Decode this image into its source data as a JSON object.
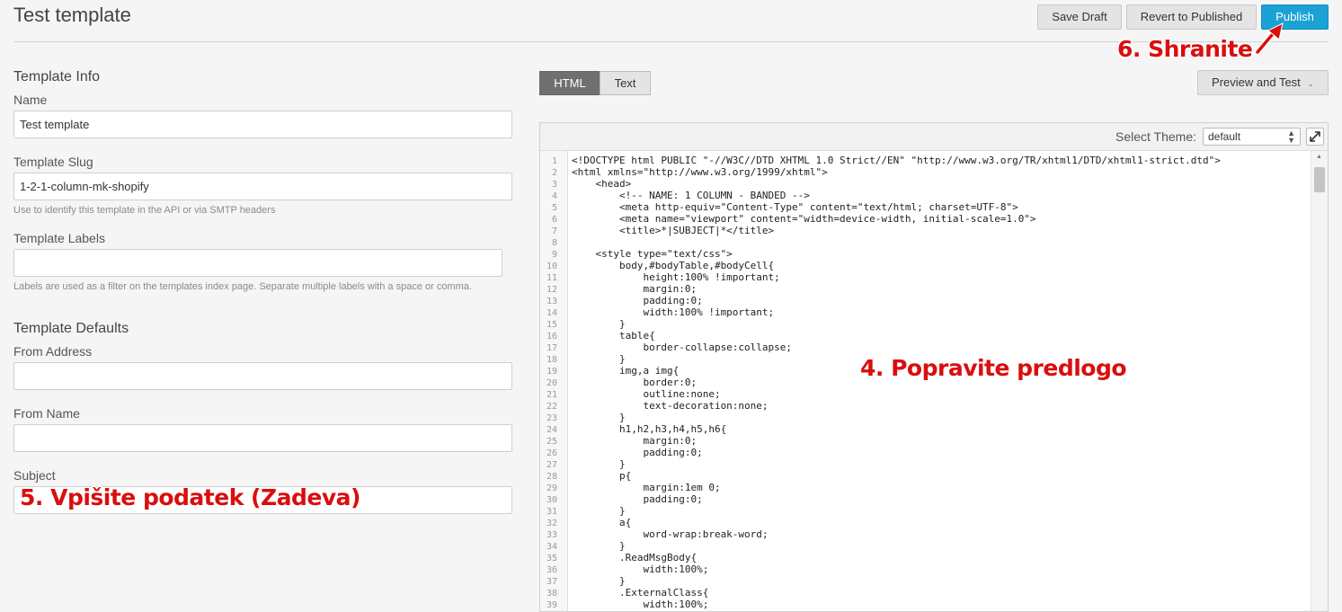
{
  "header": {
    "title": "Test template",
    "save_draft": "Save Draft",
    "revert": "Revert to Published",
    "publish": "Publish"
  },
  "template_info": {
    "section_title": "Template Info",
    "name_label": "Name",
    "name_value": "Test template",
    "slug_label": "Template Slug",
    "slug_value": "1-2-1-column-mk-shopify",
    "slug_help": "Use to identify this template in the API or via SMTP headers",
    "labels_label": "Template Labels",
    "labels_value": "",
    "labels_help": "Labels are used as a filter on the templates index page. Separate multiple labels with a space or comma."
  },
  "template_defaults": {
    "section_title": "Template Defaults",
    "from_address_label": "From Address",
    "from_address_value": "",
    "from_name_label": "From Name",
    "from_name_value": "",
    "subject_label": "Subject",
    "subject_value": ""
  },
  "editor": {
    "tabs": [
      {
        "label": "HTML",
        "active": true
      },
      {
        "label": "Text",
        "active": false
      }
    ],
    "preview_button": "Preview and Test",
    "theme_label": "Select Theme:",
    "theme_value": "default",
    "code": [
      "<!DOCTYPE html PUBLIC \"-//W3C//DTD XHTML 1.0 Strict//EN\" \"http://www.w3.org/TR/xhtml1/DTD/xhtml1-strict.dtd\">",
      "<html xmlns=\"http://www.w3.org/1999/xhtml\">",
      "    <head>",
      "        <!-- NAME: 1 COLUMN - BANDED -->",
      "        <meta http-equiv=\"Content-Type\" content=\"text/html; charset=UTF-8\">",
      "        <meta name=\"viewport\" content=\"width=device-width, initial-scale=1.0\">",
      "        <title>*|SUBJECT|*</title>",
      "",
      "    <style type=\"text/css\">",
      "        body,#bodyTable,#bodyCell{",
      "            height:100% !important;",
      "            margin:0;",
      "            padding:0;",
      "            width:100% !important;",
      "        }",
      "        table{",
      "            border-collapse:collapse;",
      "        }",
      "        img,a img{",
      "            border:0;",
      "            outline:none;",
      "            text-decoration:none;",
      "        }",
      "        h1,h2,h3,h4,h5,h6{",
      "            margin:0;",
      "            padding:0;",
      "        }",
      "        p{",
      "            margin:1em 0;",
      "            padding:0;",
      "        }",
      "        a{",
      "            word-wrap:break-word;",
      "        }",
      "        .ReadMsgBody{",
      "            width:100%;",
      "        }",
      "        .ExternalClass{",
      "            width:100%;"
    ]
  },
  "annotations": {
    "save": "6. Shranite",
    "edit": "4. Popravite predlogo",
    "subject": "5. Vpišite podatek (Zadeva)"
  },
  "colors": {
    "accent": "#1ba1d6",
    "annotation": "#d90e0e"
  }
}
